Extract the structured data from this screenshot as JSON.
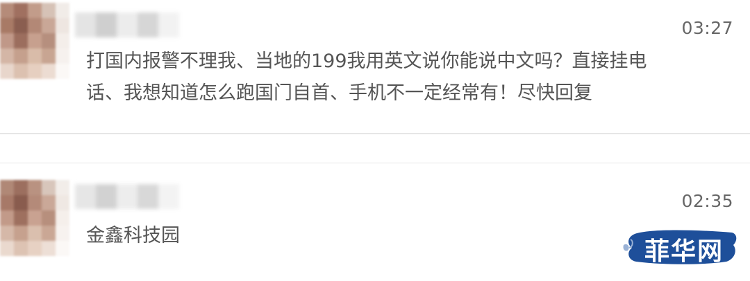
{
  "messages": [
    {
      "time": "03:27",
      "text_line1": "打国内报警不理我、当地的199我用英文说你能说中文吗？直接挂电",
      "text_line2": "话、我想知道怎么跑国门自首、手机不一定经常有！尽快回复"
    },
    {
      "time": "02:35",
      "text_line1": "金鑫科技园"
    }
  ],
  "watermark": {
    "label": "菲华网"
  },
  "colors": {
    "text": "#555555",
    "time": "#666666",
    "separator": "#e6e6e6",
    "watermark_bg": "#1e4f9a"
  }
}
